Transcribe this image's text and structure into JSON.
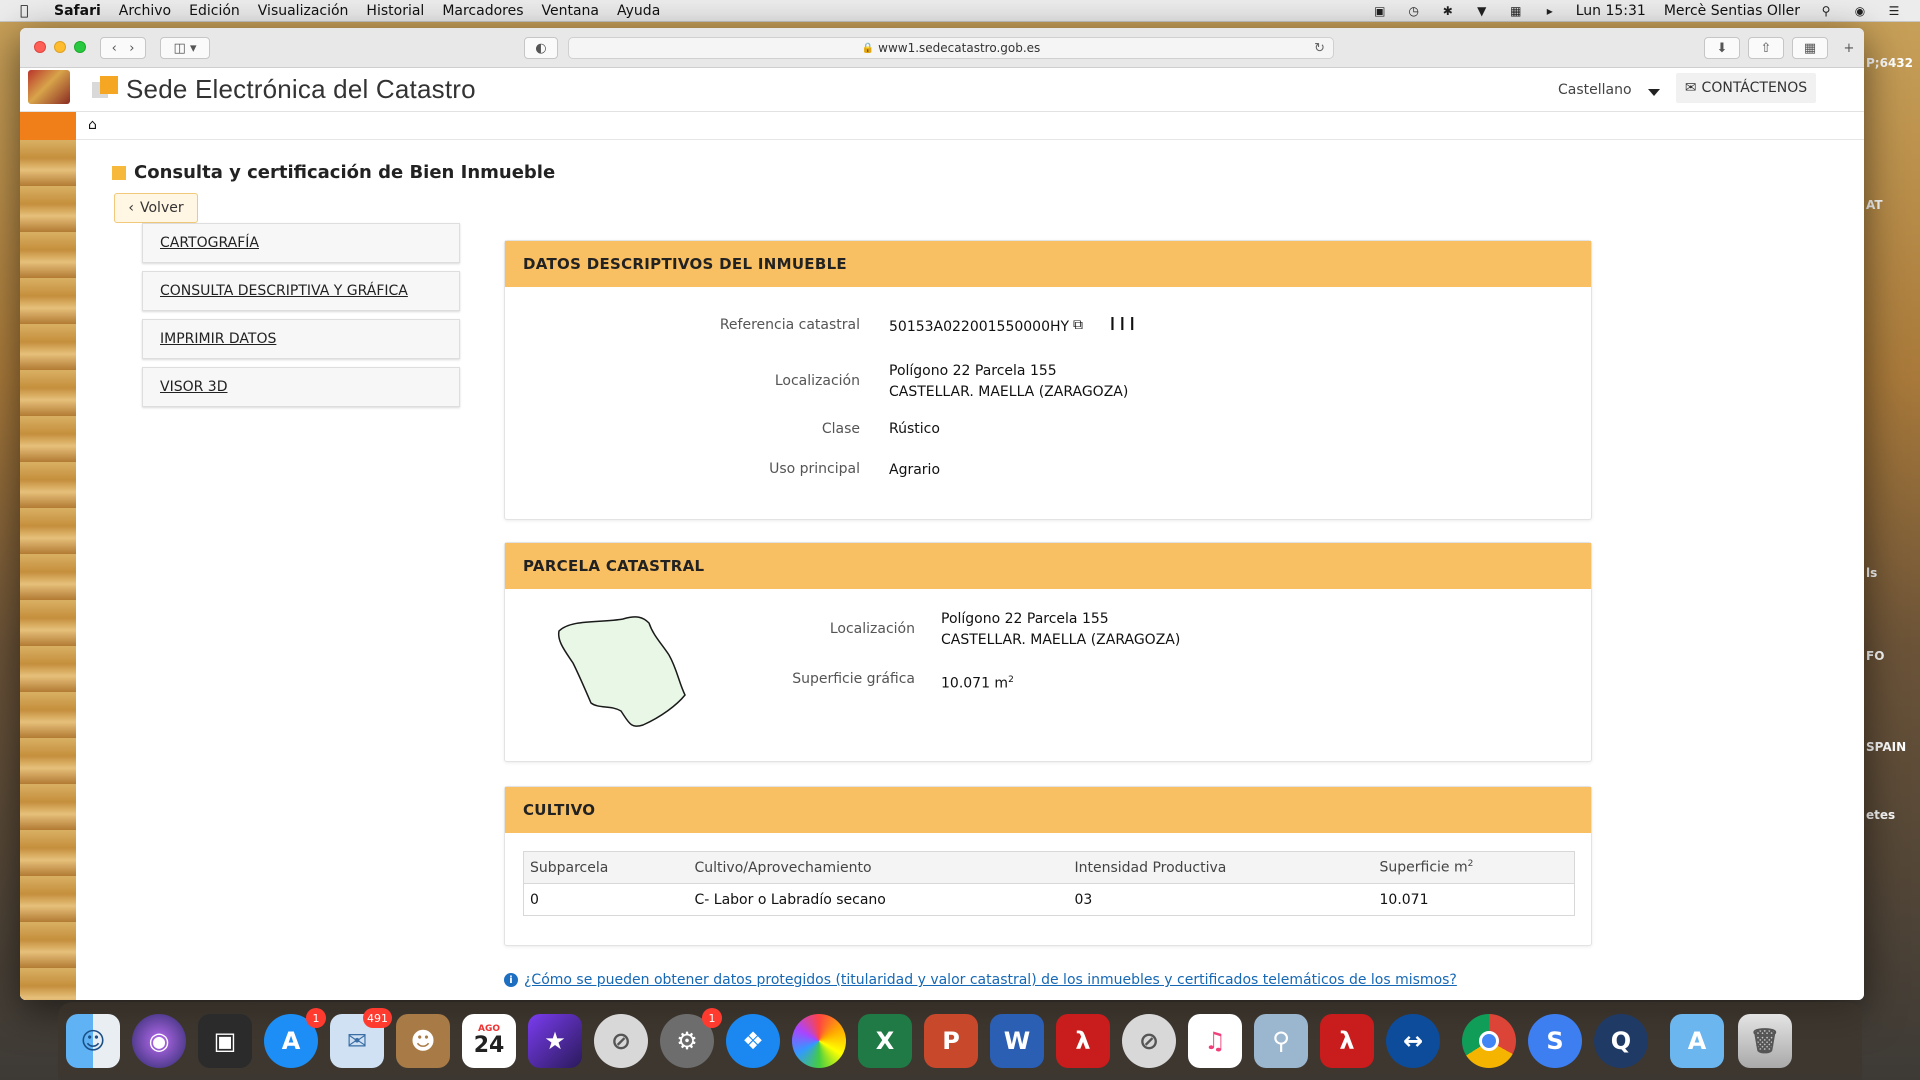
{
  "menubar": {
    "app_name": "Safari",
    "items": [
      "Archivo",
      "Edición",
      "Visualización",
      "Historial",
      "Marcadores",
      "Ventana",
      "Ayuda"
    ],
    "clock": "Lun 15:31",
    "user": "Mercè Sentias Oller"
  },
  "browser": {
    "url": "www1.sedecatastro.gob.es"
  },
  "header": {
    "site_title": "Sede Electrónica del Catastro",
    "language": "Castellano",
    "contact_label": "CONTÁCTENOS"
  },
  "page": {
    "title": "Consulta y certificación de Bien Inmueble",
    "back_label": "Volver"
  },
  "side_menu": [
    {
      "label": "CARTOGRAFÍA"
    },
    {
      "label": "CONSULTA DESCRIPTIVA Y GRÁFICA"
    },
    {
      "label": "IMPRIMIR DATOS"
    },
    {
      "label": "VISOR 3D"
    }
  ],
  "datos": {
    "heading": "DATOS DESCRIPTIVOS DEL INMUEBLE",
    "ref_label": "Referencia catastral",
    "ref_value": "50153A022001550000HY",
    "loc_label": "Localización",
    "loc_line1": "Polígono 22 Parcela 155",
    "loc_line2": "CASTELLAR. MAELLA (ZARAGOZA)",
    "clase_label": "Clase",
    "clase_value": "Rústico",
    "uso_label": "Uso principal",
    "uso_value": "Agrario"
  },
  "parcela": {
    "heading": "PARCELA CATASTRAL",
    "loc_label": "Localización",
    "loc_line1": "Polígono 22 Parcela 155",
    "loc_line2": "CASTELLAR. MAELLA (ZARAGOZA)",
    "sup_label": "Superficie gráfica",
    "sup_value": "10.071 m",
    "sup_sup": "2"
  },
  "cultivo": {
    "heading": "CULTIVO",
    "columns": [
      "Subparcela",
      "Cultivo/Aprovechamiento",
      "Intensidad Productiva",
      "Superficie m"
    ],
    "col_sup": "2",
    "rows": [
      [
        "0",
        "C- Labor o Labradío secano",
        "03",
        "10.071"
      ]
    ]
  },
  "info_link": "¿Cómo se pueden obtener datos protegidos (titularidad y valor catastral) de los inmuebles y certificados telemáticos de los mismos?",
  "background_fragments": [
    "P;6432",
    "AT",
    "ls",
    "FO",
    "SPAIN",
    "etes"
  ],
  "dock": {
    "app_store_badge": "1",
    "mail_badge": "491",
    "calendar_month": "AGO",
    "calendar_day": "24",
    "prefs_badge": "1"
  }
}
